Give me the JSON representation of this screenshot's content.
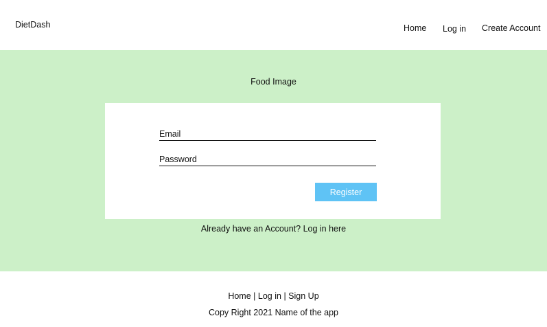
{
  "header": {
    "brand": "DietDash",
    "nav": {
      "home": "Home",
      "login": "Log in",
      "create_account": "Create Account"
    }
  },
  "hero": {
    "image_placeholder": "Food Image",
    "form": {
      "email_placeholder": "Email",
      "password_placeholder": "Password",
      "register_label": "Register"
    },
    "login_hint": "Already have an Account? Log in here"
  },
  "footer": {
    "links": {
      "home": "Home",
      "login": "Log in",
      "signup": "Sign Up",
      "separator": "|"
    },
    "copyright": "Copy Right 2021 Name of the app"
  },
  "colors": {
    "hero_background": "#ccf0c8",
    "register_button": "#5fc3f5"
  }
}
